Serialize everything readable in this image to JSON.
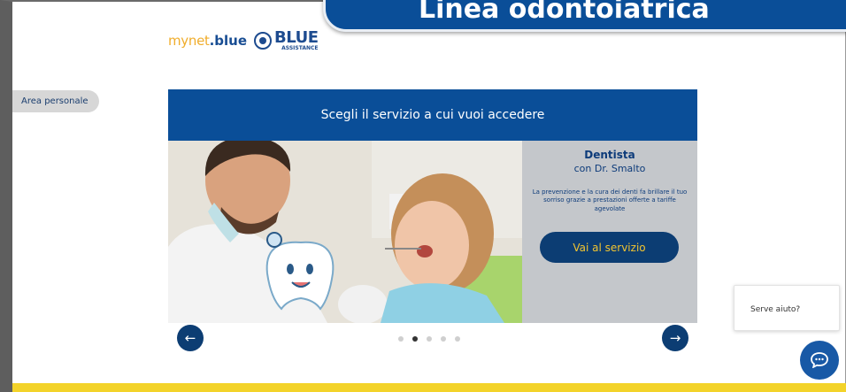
{
  "banner": {
    "title": "Linea odontoiatrica"
  },
  "logo": {
    "mynet": "mynet",
    "mynet_suffix": ".blue",
    "brand": "BLUE",
    "brand_sub": "ASSISTANCE"
  },
  "sidebar": {
    "area_personale": "Area personale"
  },
  "carousel": {
    "heading": "Scegli il servizio a cui vuoi accedere",
    "slide": {
      "title": "Dentista",
      "subtitle": "con Dr. Smalto",
      "description": "La prevenzione e la cura dei denti fa brillare il tuo sorriso grazie a prestazioni offerte a tariffe agevolate",
      "button": "Vai al servizio"
    },
    "prev_icon": "←",
    "next_icon": "→",
    "dots_count": 5,
    "active_dot": 2
  },
  "help": {
    "text": "Serve aiuto?"
  },
  "colors": {
    "primary": "#0a4e98",
    "navy": "#0c3d73",
    "accent_yellow": "#f3d32a",
    "button_text": "#f2c430"
  }
}
